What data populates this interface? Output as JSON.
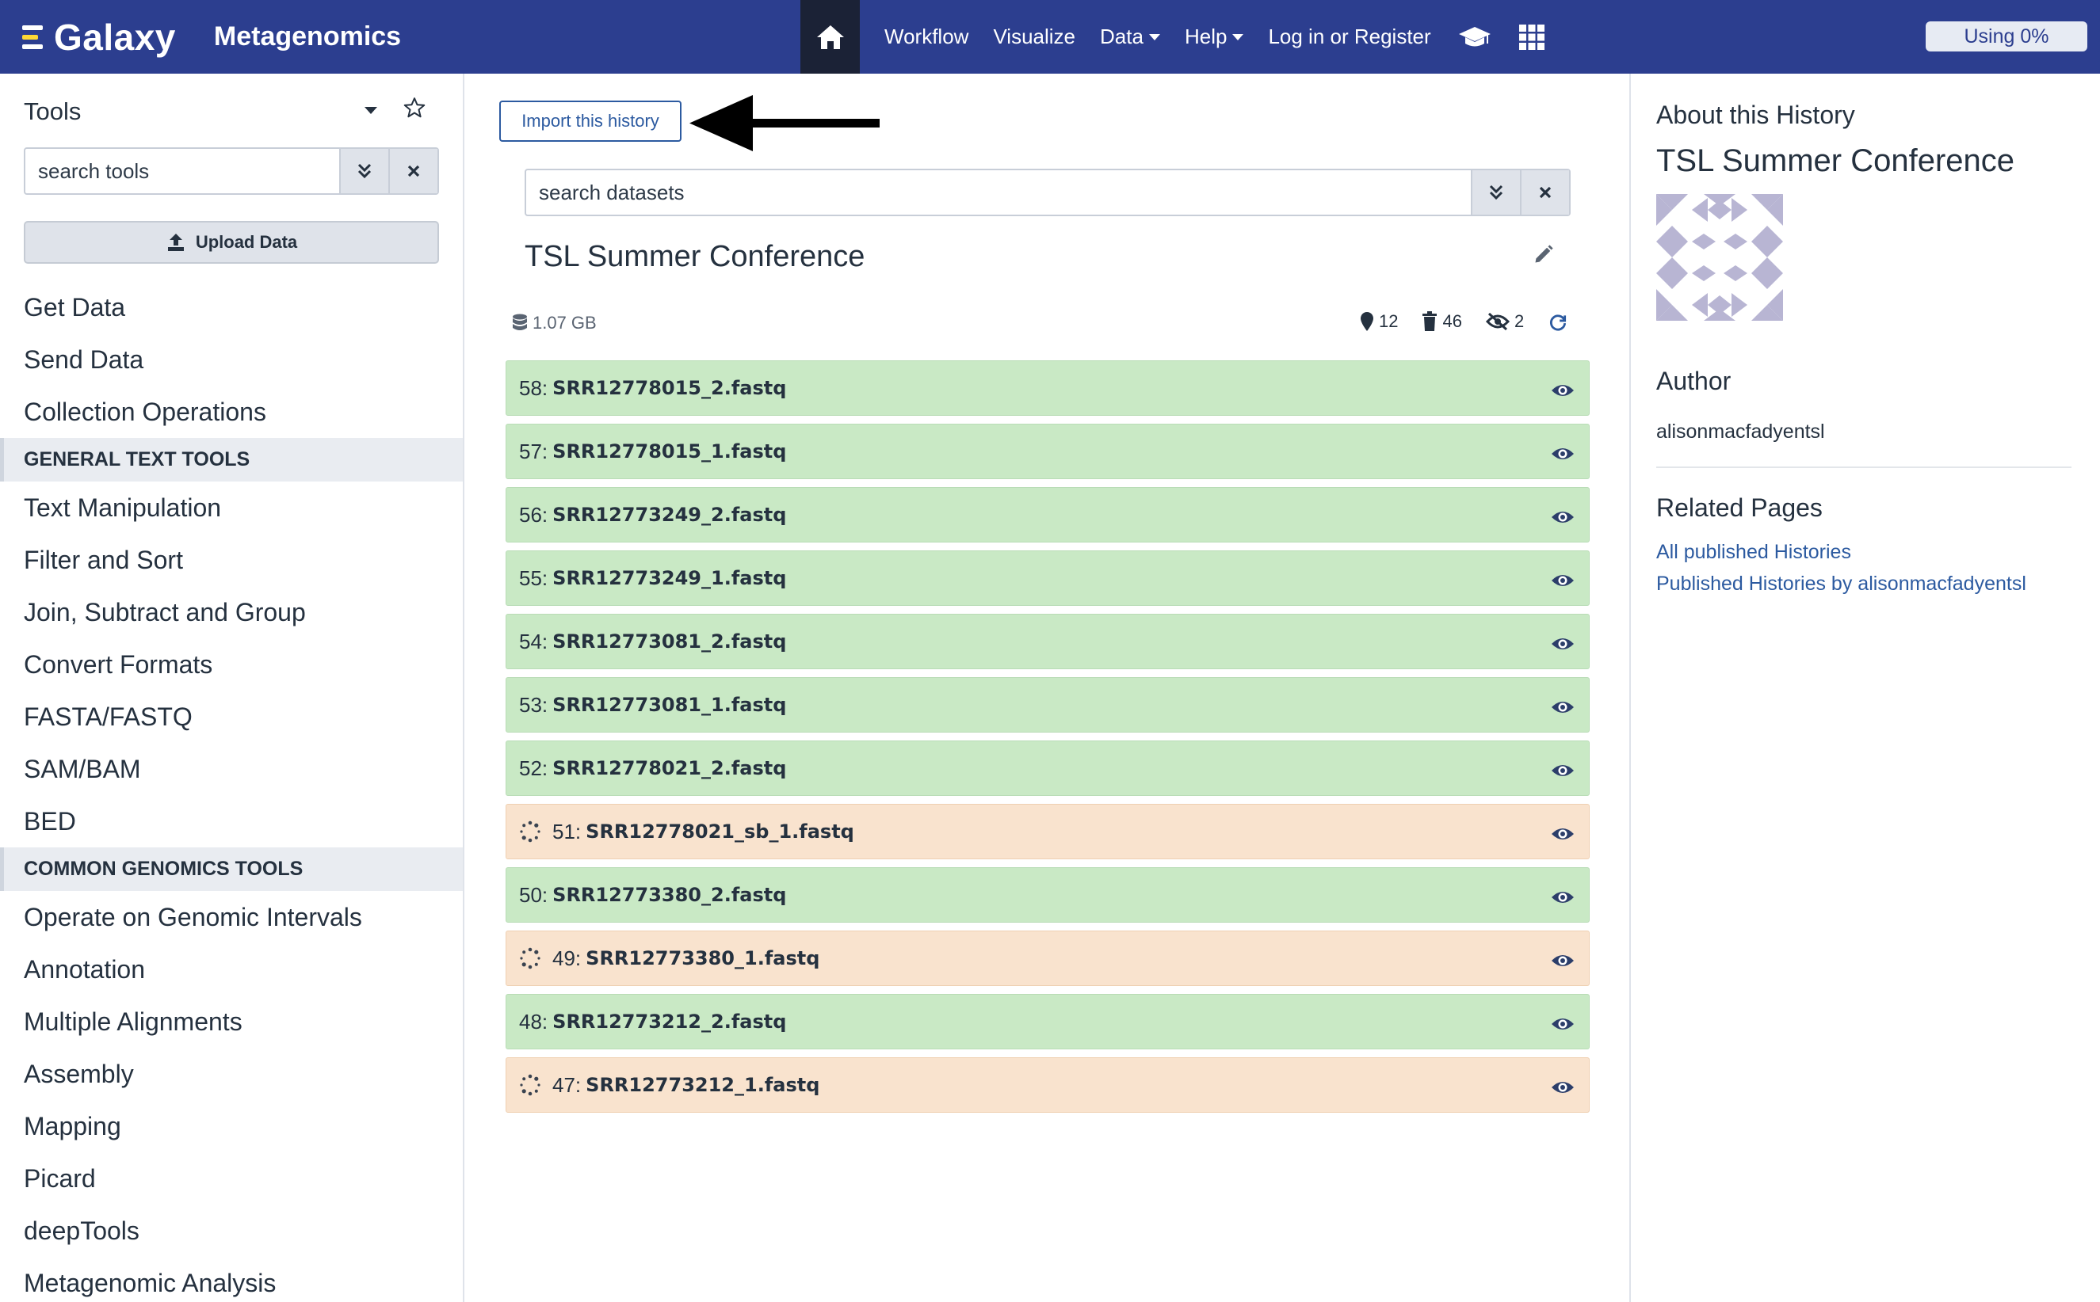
{
  "masthead": {
    "brand": "Galaxy",
    "subtitle": "Metagenomics",
    "nav": {
      "workflow": "Workflow",
      "visualize": "Visualize",
      "data": "Data",
      "help": "Help",
      "login": "Log in or Register"
    },
    "quota": "Using 0%"
  },
  "tools": {
    "title": "Tools",
    "search_placeholder": "search tools",
    "upload": "Upload Data",
    "items": [
      {
        "type": "item",
        "label": "Get Data"
      },
      {
        "type": "item",
        "label": "Send Data"
      },
      {
        "type": "item",
        "label": "Collection Operations"
      },
      {
        "type": "section",
        "label": "GENERAL TEXT TOOLS"
      },
      {
        "type": "item",
        "label": "Text Manipulation"
      },
      {
        "type": "item",
        "label": "Filter and Sort"
      },
      {
        "type": "item",
        "label": "Join, Subtract and Group"
      },
      {
        "type": "item",
        "label": "Convert Formats"
      },
      {
        "type": "item",
        "label": "FASTA/FASTQ"
      },
      {
        "type": "item",
        "label": "SAM/BAM"
      },
      {
        "type": "item",
        "label": "BED"
      },
      {
        "type": "section",
        "label": "COMMON GENOMICS TOOLS"
      },
      {
        "type": "item",
        "label": "Operate on Genomic Intervals"
      },
      {
        "type": "item",
        "label": "Annotation"
      },
      {
        "type": "item",
        "label": "Multiple Alignments"
      },
      {
        "type": "item",
        "label": "Assembly"
      },
      {
        "type": "item",
        "label": "Mapping"
      },
      {
        "type": "item",
        "label": "Picard"
      },
      {
        "type": "item",
        "label": "deepTools"
      },
      {
        "type": "item",
        "label": "Metagenomic Analysis"
      }
    ]
  },
  "history": {
    "import_label": "Import this history",
    "search_placeholder": "search datasets",
    "name": "TSL Summer Conference",
    "size": "1.07 GB",
    "shown_count": "12",
    "deleted_count": "46",
    "hidden_count": "2",
    "datasets": [
      {
        "hid": "58:",
        "name": "SRR12778015_2.fastq",
        "state": "ok"
      },
      {
        "hid": "57:",
        "name": "SRR12778015_1.fastq",
        "state": "ok"
      },
      {
        "hid": "56:",
        "name": "SRR12773249_2.fastq",
        "state": "ok"
      },
      {
        "hid": "55:",
        "name": "SRR12773249_1.fastq",
        "state": "ok"
      },
      {
        "hid": "54:",
        "name": "SRR12773081_2.fastq",
        "state": "ok"
      },
      {
        "hid": "53:",
        "name": "SRR12773081_1.fastq",
        "state": "ok"
      },
      {
        "hid": "52:",
        "name": "SRR12778021_2.fastq",
        "state": "ok"
      },
      {
        "hid": "51:",
        "name": "SRR12778021_sb_1.fastq",
        "state": "queued"
      },
      {
        "hid": "50:",
        "name": "SRR12773380_2.fastq",
        "state": "ok"
      },
      {
        "hid": "49:",
        "name": "SRR12773380_1.fastq",
        "state": "queued"
      },
      {
        "hid": "48:",
        "name": "SRR12773212_2.fastq",
        "state": "ok"
      },
      {
        "hid": "47:",
        "name": "SRR12773212_1.fastq",
        "state": "queued"
      }
    ]
  },
  "about": {
    "heading": "About this History",
    "title": "TSL Summer Conference",
    "author_heading": "Author",
    "author": "alisonmacfadyentsl",
    "related_heading": "Related Pages",
    "link_all": "All published Histories",
    "link_by_author": "Published Histories by alisonmacfadyentsl"
  },
  "colors": {
    "masthead": "#2c3e8f",
    "ok": "#c9e9c5",
    "queued": "#f9e3ce",
    "link": "#2c5aa0"
  }
}
